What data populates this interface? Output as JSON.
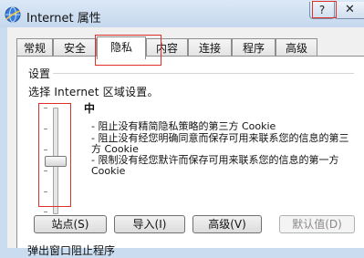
{
  "window": {
    "title": "Internet 属性",
    "help_label": "?",
    "close_label": "✕",
    "app_icon": "internet-globe-icon"
  },
  "tabs": [
    {
      "label": "常规",
      "active": false
    },
    {
      "label": "安全",
      "active": false
    },
    {
      "label": "隐私",
      "active": true
    },
    {
      "label": "内容",
      "active": false
    },
    {
      "label": "连接",
      "active": false
    },
    {
      "label": "程序",
      "active": false
    },
    {
      "label": "高级",
      "active": false
    }
  ],
  "settings": {
    "group_label": "设置",
    "zone_prompt": "选择 Internet 区域设置。",
    "level": "中",
    "slider_level_fraction": 0.5,
    "descriptions": [
      "- 阻止没有精简隐私策略的第三方 Cookie",
      "- 阻止没有经您明确同意而保存可用来联系您的信息的第三方 Cookie",
      "- 限制没有经您默许而保存可用来联系您的信息的第一方 Cookie"
    ]
  },
  "buttons": {
    "sites": "站点(S)",
    "import": "导入(I)",
    "advanced": "高级(V)",
    "default": "默认值(D)"
  },
  "popup_section_label": "弹出窗口阻止程序",
  "colors": {
    "highlight": "#e0302a",
    "titlebar": "#c9dcf0"
  }
}
